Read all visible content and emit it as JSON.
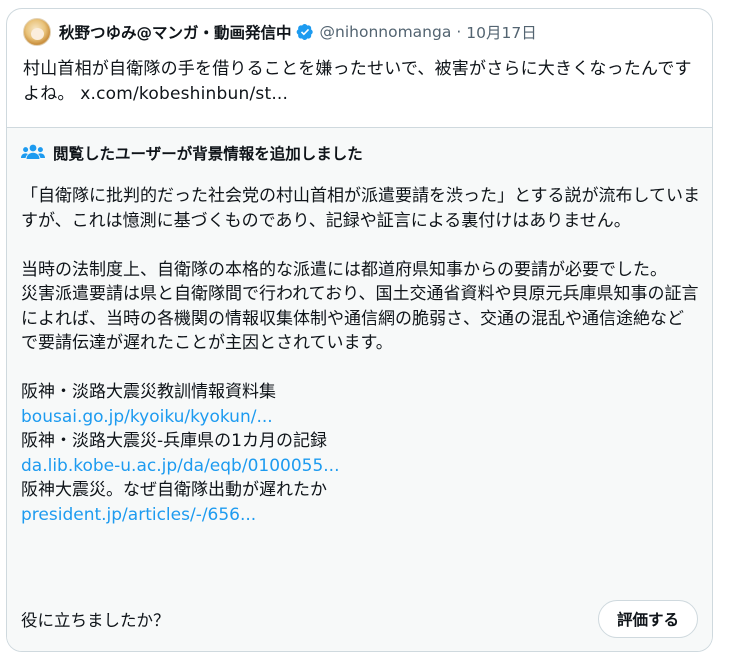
{
  "tweet": {
    "display_name": "秋野つゆみ@マンガ・動画発信中",
    "handle": "@nihonnomanga",
    "separator": "·",
    "date": "10月17日",
    "text": "村山首相が自衛隊の手を借りることを嫌ったせいで、被害がさらに大きくなったんですよね。",
    "link": "x.com/kobeshinbun/st..."
  },
  "note": {
    "title": "閲覧したユーザーが背景情報を追加しました",
    "paragraph1": "「自衛隊に批判的だった社会党の村山首相が派遣要請を渋った」とする説が流布していますが、これは憶測に基づくものであり、記録や証言による裏付けはありません。",
    "paragraph2": "当時の法制度上、自衛隊の本格的な派遣には都道府県知事からの要請が必要でした。",
    "paragraph3": "災害派遣要請は県と自衛隊間で行われており、国土交通省資料や貝原元兵庫県知事の証言によれば、当時の各機関の情報収集体制や通信網の脆弱さ、交通の混乱や通信途絶などで要請伝達が遅れたことが主因とされています。",
    "sources": [
      {
        "title": "阪神・淡路大震災教訓情報資料集",
        "url": "bousai.go.jp/kyoiku/kyokun/..."
      },
      {
        "title": "阪神・淡路大震災-兵庫県の1カ月の記録",
        "url": "da.lib.kobe-u.ac.jp/da/eqb/0100055..."
      },
      {
        "title": "阪神大震災。なぜ自衛隊出動が遅れたか",
        "url": "president.jp/articles/-/656..."
      }
    ],
    "helpful_question": "役に立ちましたか？",
    "rate_button": "評価する"
  },
  "colors": {
    "link": "#1d9bf0",
    "verified": "#1d9bf0",
    "note_bg": "#f7f9f9",
    "border": "#cfd9de"
  },
  "icons": {
    "verified": "verified-badge-icon",
    "note": "people-icon"
  }
}
